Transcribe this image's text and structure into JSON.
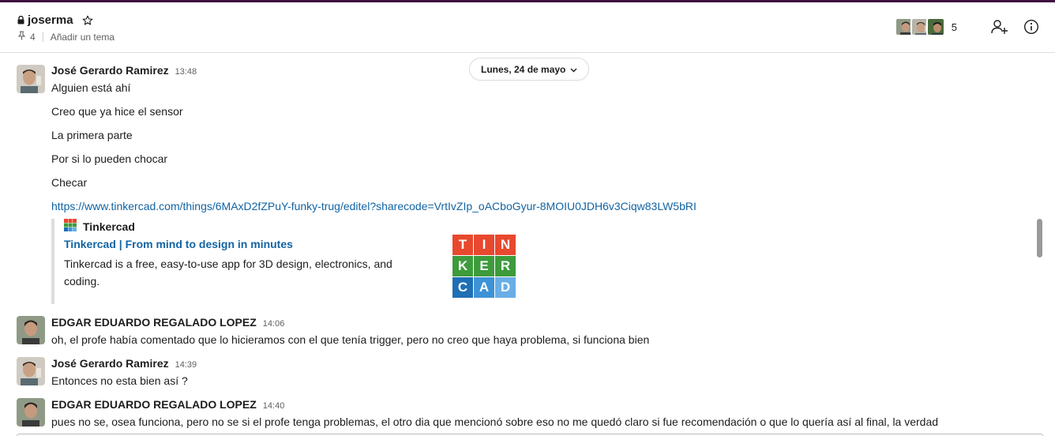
{
  "channel": {
    "name": "joserma",
    "pinned_count": "4",
    "topic_placeholder": "Añadir un tema"
  },
  "header_right": {
    "member_count": "5"
  },
  "date_divider": "Lunes, 24 de mayo",
  "messages": [
    {
      "author": "José Gerardo Ramirez",
      "time": "13:48",
      "lines": [
        "Alguien está ahí",
        "Creo que ya hice el sensor",
        "La primera parte",
        "Por si lo pueden chocar",
        "Checar"
      ],
      "link": "https://www.tinkercad.com/things/6MAxD2fZPuY-funky-trug/editel?sharecode=VrtIvZIp_oACboGyur-8MOIU0JDH6v3Ciqw83LW5bRI",
      "unfurl": {
        "site": "Tinkercad",
        "title": "Tinkercad | From mind to design in minutes",
        "description": "Tinkercad is a free, easy-to-use app for 3D design, electronics, and coding.",
        "logo_letters": [
          "T",
          "I",
          "N",
          "K",
          "E",
          "R",
          "C",
          "A",
          "D"
        ],
        "logo_colors": [
          "#e8482e",
          "#e8482e",
          "#e8482e",
          "#3d9b3c",
          "#3d9b3c",
          "#3d9b3c",
          "#1f6fb5",
          "#3d93d6",
          "#6aaee6"
        ]
      }
    },
    {
      "author": "EDGAR EDUARDO REGALADO LOPEZ",
      "time": "14:06",
      "text": "oh, el profe había comentado que lo hicieramos con el que tenía trigger, pero no creo que haya problema, si funciona bien"
    },
    {
      "author": "José Gerardo Ramirez",
      "time": "14:39",
      "text": "Entonces no esta bien así ?"
    },
    {
      "author": "EDGAR EDUARDO REGALADO LOPEZ",
      "time": "14:40",
      "text": "pues no se, osea funciona, pero no se si el profe tenga problemas, el otro dia que mencionó sobre eso no me quedó claro si fue recomendación o que lo quería así al final, la verdad"
    }
  ],
  "colors": {
    "link": "#1264a3",
    "text": "#1d1c1d",
    "muted": "#616061",
    "workspace": "#3f0e40"
  }
}
